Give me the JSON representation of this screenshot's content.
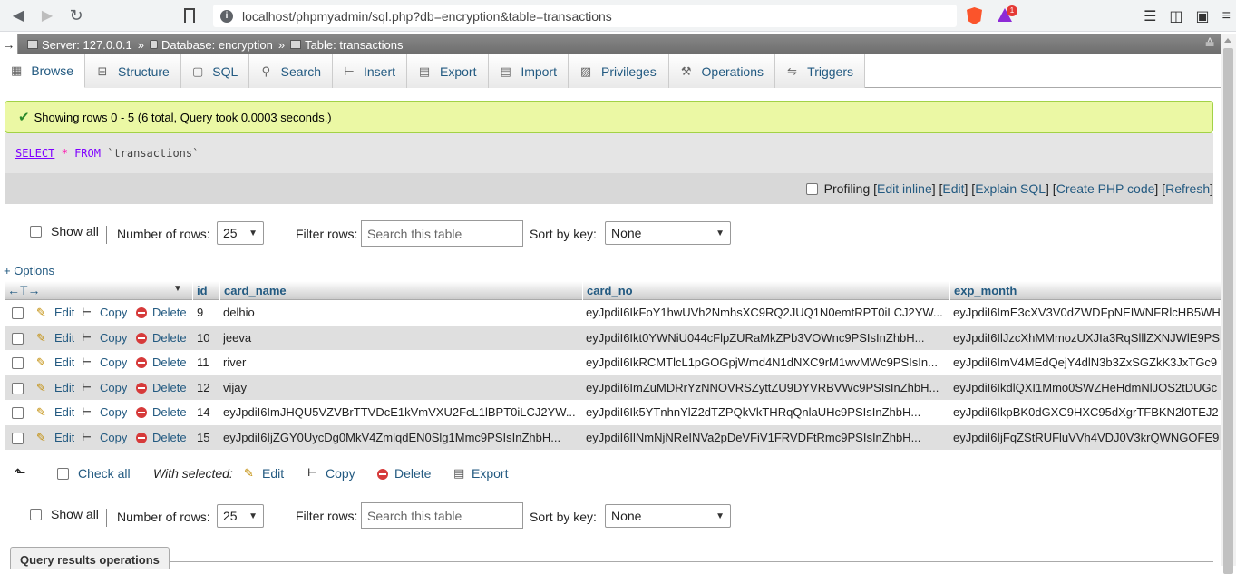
{
  "browser": {
    "url": "localhost/phpmyadmin/sql.php?db=encryption&table=transactions",
    "rewards_badge": "1"
  },
  "breadcrumb": {
    "server": "Server: 127.0.0.1",
    "database": "Database: encryption",
    "table": "Table: transactions",
    "sep": "»"
  },
  "tabs": [
    {
      "label": "Browse",
      "icon": "browse-icon"
    },
    {
      "label": "Structure",
      "icon": "structure-icon"
    },
    {
      "label": "SQL",
      "icon": "sql-icon"
    },
    {
      "label": "Search",
      "icon": "search-icon"
    },
    {
      "label": "Insert",
      "icon": "insert-icon"
    },
    {
      "label": "Export",
      "icon": "export-icon"
    },
    {
      "label": "Import",
      "icon": "import-icon"
    },
    {
      "label": "Privileges",
      "icon": "privileges-icon"
    },
    {
      "label": "Operations",
      "icon": "operations-icon"
    },
    {
      "label": "Triggers",
      "icon": "triggers-icon"
    }
  ],
  "message": "Showing rows 0 - 5 (6 total, Query took 0.0003 seconds.)",
  "sql": {
    "select": "SELECT",
    "star": "*",
    "from": "FROM",
    "table": "`transactions`"
  },
  "profiling": {
    "label": "Profiling",
    "edit_inline": "Edit inline",
    "edit": "Edit",
    "explain": "Explain SQL",
    "php": "Create PHP code",
    "refresh": "Refresh"
  },
  "nav": {
    "show_all": "Show all",
    "rows_label": "Number of rows:",
    "rows_value": "25",
    "filter_label": "Filter rows:",
    "filter_placeholder": "Search this table",
    "sort_label": "Sort by key:",
    "sort_value": "None"
  },
  "options_link": "+ Options",
  "columns": [
    "id",
    "card_name",
    "card_no",
    "exp_month"
  ],
  "actions": {
    "edit": "Edit",
    "copy": "Copy",
    "delete": "Delete"
  },
  "rows": [
    {
      "id": "9",
      "card_name": "delhio",
      "card_no": "eyJpdiI6IkFoY1hwUVh2NmhsXC9RQ2JUQ1N0emtRPT0iLCJ2YW...",
      "exp_month": "eyJpdiI6ImE3cXV3V0dZWDFpNEIWNFRlcHB5WH"
    },
    {
      "id": "10",
      "card_name": "jeeva",
      "card_no": "eyJpdiI6Ikt0YWNiU044cFlpZURaMkZPb3VOWnc9PSIsInZhbH...",
      "exp_month": "eyJpdiI6IlJzcXhMMmozUXJIa3RqSlllZXNJWlE9PS"
    },
    {
      "id": "11",
      "card_name": "river",
      "card_no": "eyJpdiI6IkRCMTlcL1pGOGpjWmd4N1dNXC9rM1wvMWc9PSIsIn...",
      "exp_month": "eyJpdiI6ImV4MEdQejY4dlN3b3ZxSGZkK3JxTGc9"
    },
    {
      "id": "12",
      "card_name": "vijay",
      "card_no": "eyJpdiI6ImZuMDRrYzNNOVRSZyttZU9DYVRBVWc9PSIsInZhbH...",
      "exp_month": "eyJpdiI6IkdlQXI1Mmo0SWZHeHdmNlJOS2tDUGc"
    },
    {
      "id": "14",
      "card_name": "eyJpdiI6ImJHQU5VZVBrTTVDcE1kVmVXU2FcL1lBPT0iLCJ2YW...",
      "card_no": "eyJpdiI6Ik5YTnhnYlZ2dTZPQkVkTHRqQnlaUHc9PSIsInZhbH...",
      "exp_month": "eyJpdiI6IkpBK0dGXC9HXC95dXgrTFBKN2l0TEJ2"
    },
    {
      "id": "15",
      "card_name": "eyJpdiI6IjZGY0UycDg0MkV4ZmlqdEN0Slg1Mmc9PSIsInZhbH...",
      "card_no": "eyJpdiI6IlNmNjNReINVa2pDeVFiV1FRVDFtRmc9PSIsInZhbH...",
      "exp_month": "eyJpdiI6IjFqZStRUFluVVh4VDJ0V3krQWNGOFE9"
    }
  ],
  "with_selected": {
    "check_all": "Check all",
    "label": "With selected:",
    "edit": "Edit",
    "copy": "Copy",
    "delete": "Delete",
    "export": "Export"
  },
  "query_results_ops": "Query results operations"
}
